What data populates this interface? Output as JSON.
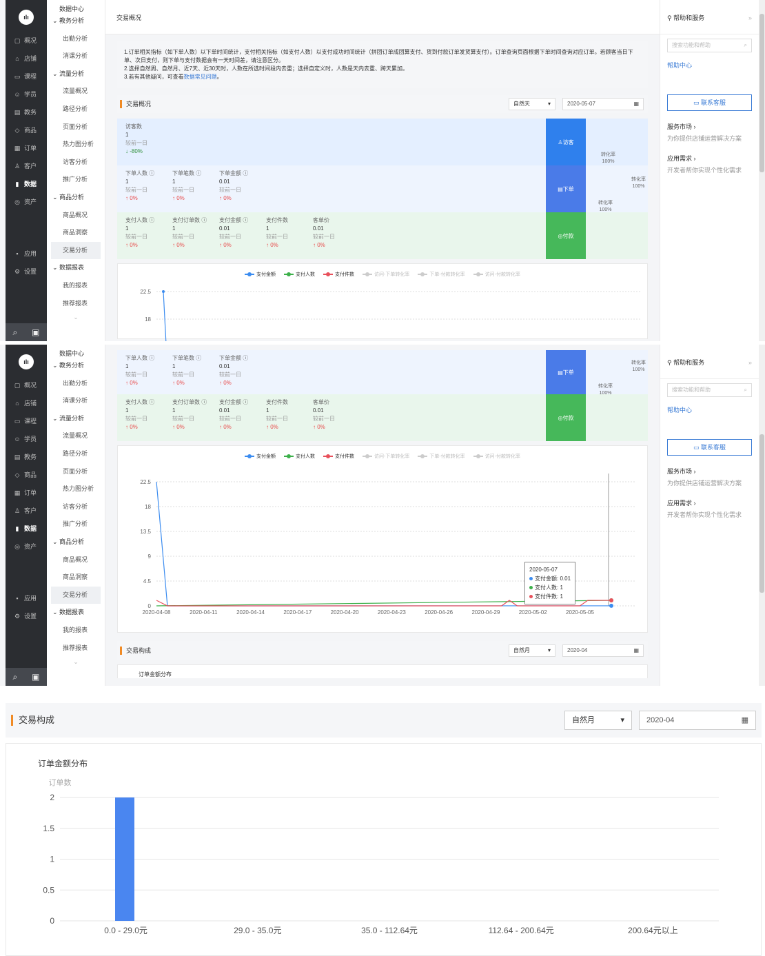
{
  "nav": {
    "logo": "ıIı",
    "items": [
      {
        "icon": "▢",
        "label": "概况"
      },
      {
        "icon": "⌂",
        "label": "店铺"
      },
      {
        "icon": "▭",
        "label": "课程"
      },
      {
        "icon": "☺",
        "label": "学员"
      },
      {
        "icon": "▤",
        "label": "教务"
      },
      {
        "icon": "◇",
        "label": "商品"
      },
      {
        "icon": "▦",
        "label": "订单"
      },
      {
        "icon": "♙",
        "label": "客户"
      },
      {
        "icon": "▮",
        "label": "数据"
      },
      {
        "icon": "◎",
        "label": "资产"
      }
    ],
    "extra": [
      {
        "icon": "▪",
        "label": "应用"
      },
      {
        "icon": "⚙",
        "label": "设置"
      }
    ]
  },
  "subnav": {
    "head": "数据中心",
    "items": [
      {
        "label": "教务分析",
        "group": true
      },
      {
        "label": "出勤分析"
      },
      {
        "label": "消课分析"
      },
      {
        "label": "流量分析",
        "group": true
      },
      {
        "label": "流量概况"
      },
      {
        "label": "路径分析"
      },
      {
        "label": "页面分析"
      },
      {
        "label": "热力图分析"
      },
      {
        "label": "访客分析"
      },
      {
        "label": "推广分析"
      },
      {
        "label": "商品分析",
        "group": true
      },
      {
        "label": "商品概况"
      },
      {
        "label": "商品洞察"
      },
      {
        "label": "交易分析",
        "active": true
      },
      {
        "label": "数据报表",
        "group": true
      },
      {
        "label": "我的报表"
      },
      {
        "label": "推荐报表"
      }
    ]
  },
  "topbar": {
    "title": "交易概况"
  },
  "help": {
    "title": "帮助和服务",
    "collapse": "»",
    "search_placeholder": "搜索功能和帮助",
    "center": "帮助中心",
    "contact": "联系客服",
    "market": "服务市场 ›",
    "market_sub": "为你提供店铺运营解决方案",
    "demand": "应用需求 ›",
    "demand_sub": "开发者帮你实现个性化需求"
  },
  "notice": {
    "line1": "1.订单相关指标（如下单人数）以下单时间统计，支付相关指标（如支付人数）以支付成功时间统计（拼团订单成团算支付、货到付款订单发货算支付）。订单查询页面根据下单时间查询对应订单。若顾客当日下单、次日支付，则下单与支付数据会有一天时间差，请注意区分。",
    "line2": "2.选择自然周、自然月、近7天、近30天时，人数在所选时间段内去重；选择自定义时，人数是天内去重、跨天累加。",
    "line3_pre": "3.若有其他疑问，可查看",
    "line3_link": "数据常见问题",
    "line3_post": "。"
  },
  "overview": {
    "title": "交易概况",
    "period": "自然天",
    "date": "2020-05-07",
    "visitor": {
      "label": "访客数",
      "value": "1",
      "cmp": "较前一日",
      "change": "↓ -80%"
    },
    "order_metrics": [
      {
        "label": "下单人数 ⓘ",
        "value": "1",
        "cmp": "较前一日",
        "change": "↑ 0%"
      },
      {
        "label": "下单笔数 ⓘ",
        "value": "1",
        "cmp": "较前一日",
        "change": "↑ 0%"
      },
      {
        "label": "下单金额 ⓘ",
        "value": "0.01",
        "cmp": "较前一日",
        "change": "↑ 0%"
      }
    ],
    "pay_metrics": [
      {
        "label": "支付人数 ⓘ",
        "value": "1",
        "cmp": "较前一日",
        "change": "↑ 0%"
      },
      {
        "label": "支付订单数 ⓘ",
        "value": "1",
        "cmp": "较前一日",
        "change": "↑ 0%"
      },
      {
        "label": "支付金额 ⓘ",
        "value": "0.01",
        "cmp": "较前一日",
        "change": "↑ 0%"
      },
      {
        "label": "支付件数",
        "value": "1",
        "cmp": "较前一日",
        "change": "↑ 0%"
      },
      {
        "label": "客单价",
        "value": "0.01",
        "cmp": "较前一日",
        "change": "↑ 0%"
      }
    ],
    "steps": {
      "visit": "访客",
      "order": "下单",
      "pay": "付款"
    },
    "rates": {
      "label": "转化率",
      "value": "100%"
    }
  },
  "colors": {
    "blue": "#3b8cf0",
    "green": "#3cb04a",
    "red": "#e8505b",
    "funnel_blue": "#2f80ed",
    "funnel_order": "#4a7be8",
    "funnel_green": "#46b85a",
    "accent": "#f08a24",
    "bar": "#4a86f0"
  },
  "trend": {
    "legend": [
      {
        "name": "支付金额",
        "color": "#3b8cf0",
        "on": true
      },
      {
        "name": "支付人数",
        "color": "#3cb04a",
        "on": true
      },
      {
        "name": "支付件数",
        "color": "#e8505b",
        "on": true
      },
      {
        "name": "访问-下单转化率",
        "color": "#ccc",
        "on": false
      },
      {
        "name": "下单-付款转化率",
        "color": "#ccc",
        "on": false
      },
      {
        "name": "访问-付款转化率",
        "color": "#ccc",
        "on": false
      }
    ],
    "tooltip": {
      "date": "2020-05-07",
      "rows": [
        {
          "text": "支付金额: 0.01",
          "color": "#3b8cf0"
        },
        {
          "text": "支付人数: 1",
          "color": "#3cb04a"
        },
        {
          "text": "支付件数: 1",
          "color": "#e8505b"
        }
      ]
    }
  },
  "composition": {
    "title": "交易构成",
    "period": "自然月",
    "date": "2020-04",
    "chart_title": "订单金额分布",
    "preview_label": "订单金额分布"
  },
  "chart_data": [
    {
      "type": "line",
      "x": [
        "2020-04-08",
        "2020-04-11",
        "2020-04-14",
        "2020-04-17",
        "2020-04-20",
        "2020-04-23",
        "2020-04-26",
        "2020-04-29",
        "2020-05-02",
        "2020-05-05"
      ],
      "yticks": [
        "0",
        "4.5",
        "9",
        "13.5",
        "18",
        "22.5"
      ],
      "ylim": [
        0,
        24
      ],
      "xlim": [
        0,
        29
      ],
      "series": [
        {
          "name": "支付金额",
          "color": "#3b8cf0",
          "points": [
            [
              0,
              22.5
            ],
            [
              0.7,
              0
            ],
            [
              29,
              0.01
            ]
          ]
        },
        {
          "name": "支付人数",
          "color": "#3cb04a",
          "points": [
            [
              0,
              0
            ],
            [
              29,
              1
            ]
          ]
        },
        {
          "name": "支付件数",
          "color": "#e8505b",
          "points": [
            [
              0,
              1
            ],
            [
              0.7,
              0
            ],
            [
              22,
              0
            ],
            [
              22.5,
              1
            ],
            [
              23,
              0
            ],
            [
              27,
              0
            ],
            [
              27.5,
              1
            ],
            [
              29,
              1
            ]
          ]
        }
      ]
    },
    {
      "type": "bar",
      "title": "订单金额分布",
      "ylabel": "订单数",
      "categories": [
        "0.0 - 29.0元",
        "29.0 - 35.0元",
        "35.0 - 112.64元",
        "112.64 - 200.64元",
        "200.64元以上"
      ],
      "values": [
        2,
        0,
        0,
        0,
        0
      ],
      "yticks": [
        "0",
        "0.5",
        "1",
        "1.5",
        "2"
      ],
      "ylim": [
        0,
        2
      ]
    }
  ]
}
